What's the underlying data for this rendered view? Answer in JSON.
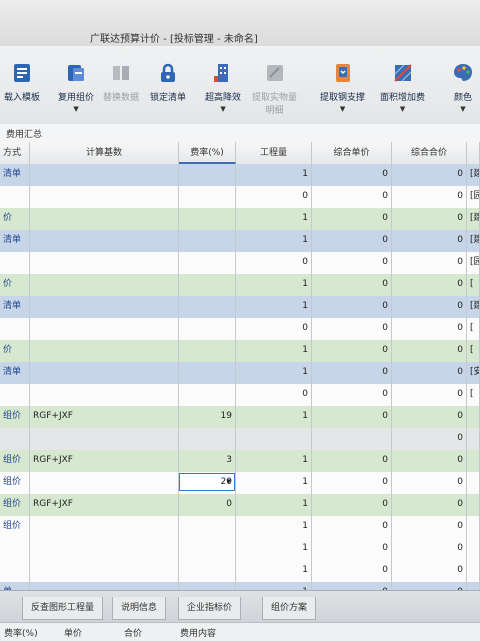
{
  "window": {
    "title": "广联达预算计价 - [投标管理 - 未命名]"
  },
  "toolbar": {
    "items": [
      {
        "label": "载入模板",
        "icon": "load-template-icon",
        "enabled": true
      },
      {
        "label": "复用组价",
        "icon": "reuse-price-icon",
        "enabled": true
      },
      {
        "label": "替换数据",
        "icon": "replace-data-icon",
        "enabled": false
      },
      {
        "label": "锁定清单",
        "icon": "lock-icon",
        "enabled": true
      },
      {
        "label": "超高降效",
        "icon": "building-icon",
        "enabled": true
      },
      {
        "label": "提取实物量",
        "label2": "明细",
        "icon": "extract-icon",
        "enabled": false
      },
      {
        "label": "提取钢支撑",
        "icon": "extract-steel-icon",
        "enabled": true
      },
      {
        "label": "面积增加费",
        "icon": "area-fee-icon",
        "enabled": true
      },
      {
        "label": "颜色",
        "icon": "color-icon",
        "enabled": true
      }
    ]
  },
  "subtab": {
    "label": "费用汇总"
  },
  "grid": {
    "columns": [
      "方式",
      "计算基数",
      "费率(%)",
      "工程量",
      "综合单价",
      "综合合价",
      ""
    ],
    "rows": [
      {
        "c0": "清单",
        "c1": "",
        "c2": "",
        "c3": "1",
        "c4": "0",
        "c5": "0",
        "c6": "[建"
      },
      {
        "c0": "",
        "c1": "",
        "c2": "",
        "c3": "0",
        "c4": "0",
        "c5": "0",
        "c6": "[园"
      },
      {
        "c0": "价",
        "c1": "",
        "c2": "",
        "c3": "1",
        "c4": "0",
        "c5": "0",
        "c6": "[建"
      },
      {
        "c0": "清单",
        "c1": "",
        "c2": "",
        "c3": "1",
        "c4": "0",
        "c5": "0",
        "c6": "[建"
      },
      {
        "c0": "",
        "c1": "",
        "c2": "",
        "c3": "0",
        "c4": "0",
        "c5": "0",
        "c6": "[园"
      },
      {
        "c0": "价",
        "c1": "",
        "c2": "",
        "c3": "1",
        "c4": "0",
        "c5": "0",
        "c6": "["
      },
      {
        "c0": "清单",
        "c1": "",
        "c2": "",
        "c3": "1",
        "c4": "0",
        "c5": "0",
        "c6": "[建"
      },
      {
        "c0": "",
        "c1": "",
        "c2": "",
        "c3": "0",
        "c4": "0",
        "c5": "0",
        "c6": "["
      },
      {
        "c0": "价",
        "c1": "",
        "c2": "",
        "c3": "1",
        "c4": "0",
        "c5": "0",
        "c6": "["
      },
      {
        "c0": "清单",
        "c1": "",
        "c2": "",
        "c3": "1",
        "c4": "0",
        "c5": "0",
        "c6": "[安"
      },
      {
        "c0": "",
        "c1": "",
        "c2": "",
        "c3": "0",
        "c4": "0",
        "c5": "0",
        "c6": "["
      },
      {
        "c0": "组价",
        "c1": "RGF+JXF",
        "c2": "19",
        "c3": "1",
        "c4": "0",
        "c5": "0",
        "c6": ""
      },
      {
        "c0": "",
        "c1": "",
        "c2": "",
        "c3": "",
        "c4": "",
        "c5": "0",
        "c6": ""
      },
      {
        "c0": "组价",
        "c1": "RGF+JXF",
        "c2": "3",
        "c3": "1",
        "c4": "0",
        "c5": "0",
        "c6": ""
      },
      {
        "c0": "组价",
        "c1": "",
        "c2": "20",
        "c3": "1",
        "c4": "0",
        "c5": "0",
        "c6": ""
      },
      {
        "c0": "组价",
        "c1": "RGF+JXF",
        "c2": "0",
        "c3": "1",
        "c4": "0",
        "c5": "0",
        "c6": ""
      },
      {
        "c0": "组价",
        "c1": "",
        "c2": "",
        "c3": "1",
        "c4": "0",
        "c5": "0",
        "c6": ""
      },
      {
        "c0": "",
        "c1": "",
        "c2": "",
        "c3": "1",
        "c4": "0",
        "c5": "0",
        "c6": ""
      },
      {
        "c0": "",
        "c1": "",
        "c2": "",
        "c3": "1",
        "c4": "0",
        "c5": "0",
        "c6": ""
      },
      {
        "c0": "单",
        "c1": "",
        "c2": "",
        "c3": "1",
        "c4": "0",
        "c5": "0",
        "c6": ""
      },
      {
        "c0": "",
        "c1": "",
        "c2": "",
        "c3": "0",
        "c4": "0",
        "c5": "0",
        "c6": ""
      }
    ]
  },
  "bottom_tabs": [
    "反查图形工程量",
    "说明信息",
    "企业指标价",
    "组价方案"
  ],
  "footer": {
    "items": [
      "费率(%)",
      "单价",
      "合价",
      "费用内容"
    ]
  }
}
